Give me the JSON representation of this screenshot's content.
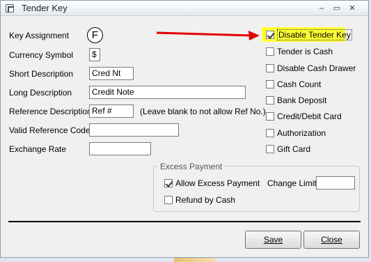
{
  "window": {
    "title": "Tender Key"
  },
  "form": {
    "key_assignment": {
      "label": "Key Assignment",
      "value": "F"
    },
    "currency_symbol": {
      "label": "Currency Symbol",
      "value": "$"
    },
    "short_description": {
      "label": "Short Description",
      "value": "Cred Nt"
    },
    "long_description": {
      "label": "Long Description",
      "value": "Credit Note"
    },
    "reference_description": {
      "label": "Reference Description",
      "value": "Ref #",
      "hint": "(Leave blank to not allow Ref No.)"
    },
    "valid_reference_code": {
      "label": "Valid Reference Code",
      "value": ""
    },
    "exchange_rate": {
      "label": "Exchange Rate",
      "value": ""
    }
  },
  "options": [
    {
      "label": "Disable Tender Key",
      "checked": true
    },
    {
      "label": "Tender is Cash",
      "checked": false
    },
    {
      "label": "Disable Cash Drawer",
      "checked": false
    },
    {
      "label": "Cash Count",
      "checked": false
    },
    {
      "label": "Bank Deposit",
      "checked": false
    },
    {
      "label": "Credit/Debit Card",
      "checked": false
    },
    {
      "label": "Authorization",
      "checked": false
    },
    {
      "label": "Gift Card",
      "checked": false
    }
  ],
  "excess_payment": {
    "title": "Excess Payment",
    "allow": {
      "label": "Allow Excess Payment",
      "checked": true
    },
    "refund": {
      "label": "Refund by Cash",
      "checked": false
    },
    "change_limit": {
      "label": "Change Limit",
      "value": ""
    }
  },
  "buttons": {
    "save": "Save",
    "close": "Close"
  },
  "colors": {
    "highlight": "#ffff33",
    "arrow": "#e00000"
  },
  "icons": {
    "minimize": "minimize-icon",
    "maximize": "maximize-icon",
    "close": "close-icon"
  }
}
